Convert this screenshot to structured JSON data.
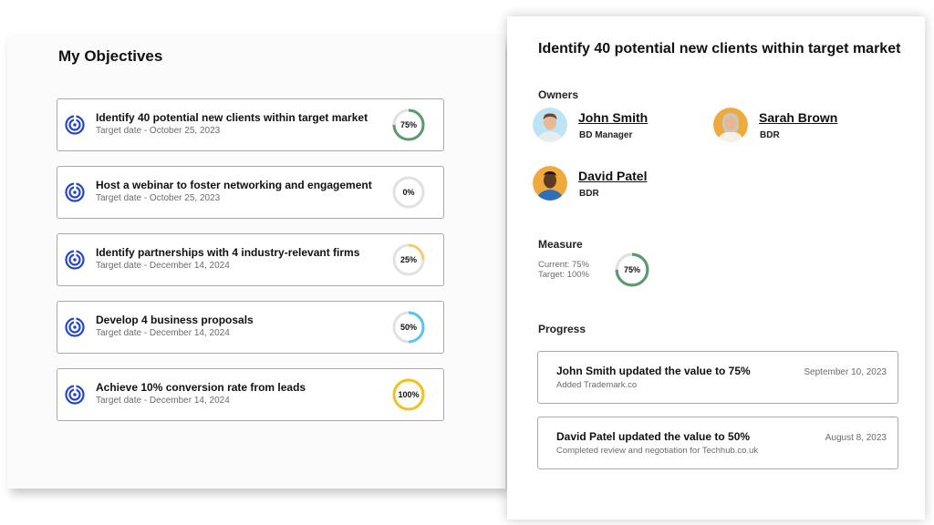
{
  "objectives_panel": {
    "title": "My Objectives",
    "items": [
      {
        "title": "Identify 40 potential new clients within target market",
        "date": "Target date - October 25, 2023",
        "progress_label": "75%",
        "progress": 0.75,
        "color": "#5a9a6e"
      },
      {
        "title": "Host a webinar to foster networking and engagement",
        "date": "Target date - October 25, 2023",
        "progress_label": "0%",
        "progress": 0,
        "color": "#5a9a6e"
      },
      {
        "title": "Identify partnerships with 4 industry-relevant firms",
        "date": "Target date - December 14, 2024",
        "progress_label": "25%",
        "progress": 0.25,
        "color": "#f2cd6e"
      },
      {
        "title": "Develop 4 business proposals",
        "date": "Target date - December 14, 2024",
        "progress_label": "50%",
        "progress": 0.5,
        "color": "#5cc3ef"
      },
      {
        "title": "Achieve 10% conversion rate from leads",
        "date": "Target date - December 14, 2024",
        "progress_label": "100%",
        "progress": 1.0,
        "color": "#f2c21c"
      }
    ],
    "icon": "target-icon",
    "icon_color": "#2547c7"
  },
  "detail": {
    "title": "Identify 40 potential new clients within target market",
    "owners_label": "Owners",
    "owners": [
      {
        "name": "John Smith",
        "role": "BD Manager",
        "avatar": "avatar-john-smith"
      },
      {
        "name": "Sarah Brown",
        "role": "BDR",
        "avatar": "avatar-sarah-brown"
      },
      {
        "name": "David Patel",
        "role": "BDR",
        "avatar": "avatar-david-patel"
      }
    ],
    "measure_label": "Measure",
    "measure_current": "Current: 75%",
    "measure_target": "Target: 100%",
    "measure_ring_label": "75%",
    "measure_progress": 0.75,
    "measure_color": "#5a9a6e",
    "progress_label": "Progress",
    "updates": [
      {
        "title": "John Smith updated the value to 75%",
        "subtitle": "Added Trademark.co",
        "date": "September 10, 2023"
      },
      {
        "title": "David Patel updated the value to 50%",
        "subtitle": "Completed review and negotiation for Techhub.co.uk",
        "date": "August 8, 2023"
      }
    ]
  },
  "colors": {
    "ring_track": "#e1e1e1",
    "card_border": "#a9a9a9"
  }
}
